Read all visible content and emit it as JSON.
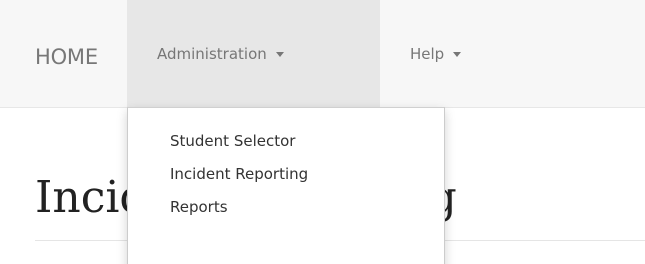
{
  "navbar": {
    "brand": "HOME",
    "items": [
      {
        "label": "Administration",
        "has_caret": true,
        "active": true
      },
      {
        "label": "Help",
        "has_caret": true,
        "active": false
      }
    ]
  },
  "dropdown": {
    "items": [
      {
        "label": "Student Selector"
      },
      {
        "label": "Incident Reporting"
      },
      {
        "label": "Reports"
      }
    ]
  },
  "page": {
    "title": "Incident Reporting"
  },
  "colors": {
    "navbar_bg": "#f7f7f7",
    "active_nav_bg": "#e7e7e7",
    "nav_text": "#777777",
    "heading_text": "#222222",
    "dropdown_text": "#333333"
  }
}
